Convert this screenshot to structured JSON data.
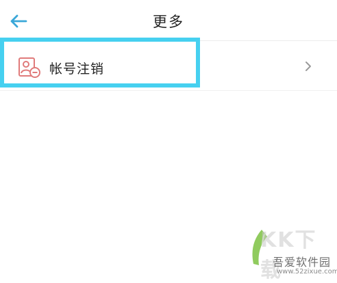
{
  "header": {
    "back_icon": "arrow-left-icon",
    "title": "更多"
  },
  "items": [
    {
      "icon": "account-remove-icon",
      "label": "帐号注销",
      "trailing_icon": "chevron-right-icon"
    }
  ],
  "watermark": {
    "big_text": "KK下载",
    "title": "吾爱软件园",
    "url": "www.52zixue.com"
  },
  "colors": {
    "accent": "#3aa7d8",
    "highlight": "#46d0f0",
    "icon": "#e07a7a"
  }
}
